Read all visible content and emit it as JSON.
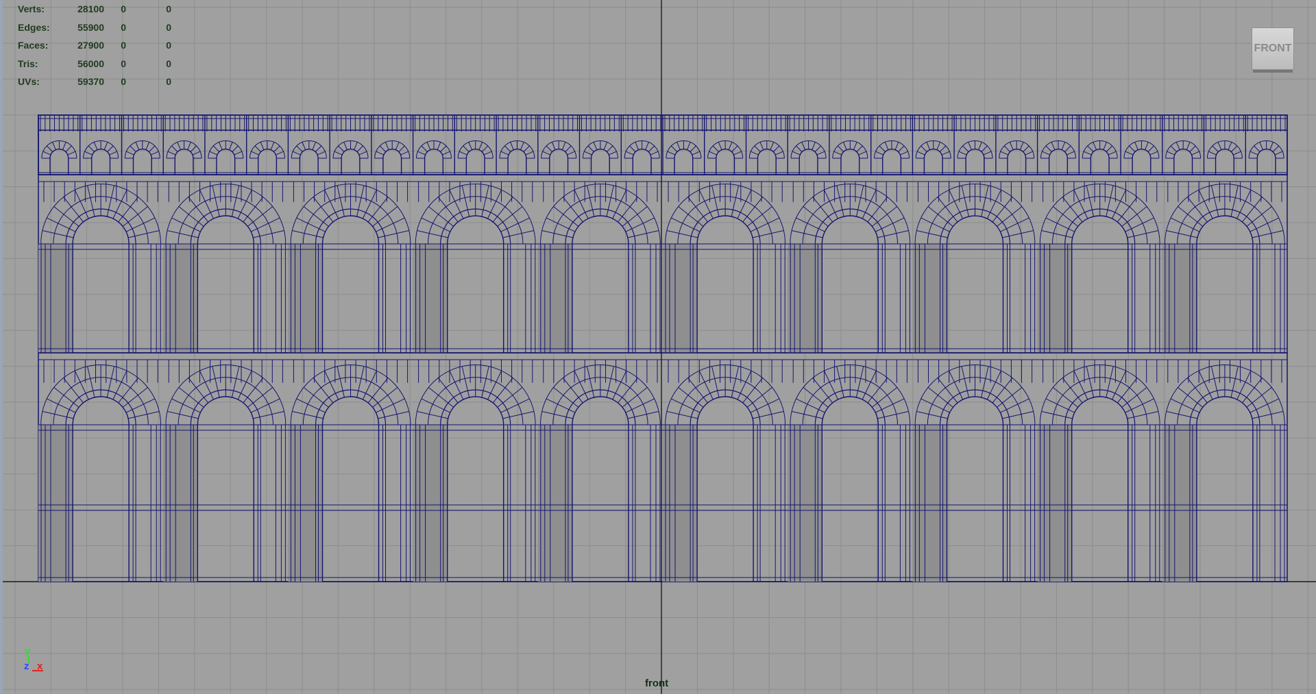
{
  "viewport": {
    "camera": "front",
    "view_cube_label": "FRONT"
  },
  "hud": {
    "rows": [
      {
        "label": "Verts:",
        "value": "28100",
        "sel": "0",
        "comp": "0"
      },
      {
        "label": "Edges:",
        "value": "55900",
        "sel": "0",
        "comp": "0"
      },
      {
        "label": "Faces:",
        "value": "27900",
        "sel": "0",
        "comp": "0"
      },
      {
        "label": "Tris:",
        "value": "56000",
        "sel": "0",
        "comp": "0"
      },
      {
        "label": "UVs:",
        "value": "59370",
        "sel": "0",
        "comp": "0"
      }
    ]
  },
  "axis": {
    "y": "y",
    "z": "z",
    "x": "x"
  },
  "colors": {
    "background": "#a0a0a0",
    "grid": "#8c8c8c",
    "origin_axis": "#1a1a1a",
    "wireframe": "#141470",
    "hud_text": "#1f3a1f"
  }
}
